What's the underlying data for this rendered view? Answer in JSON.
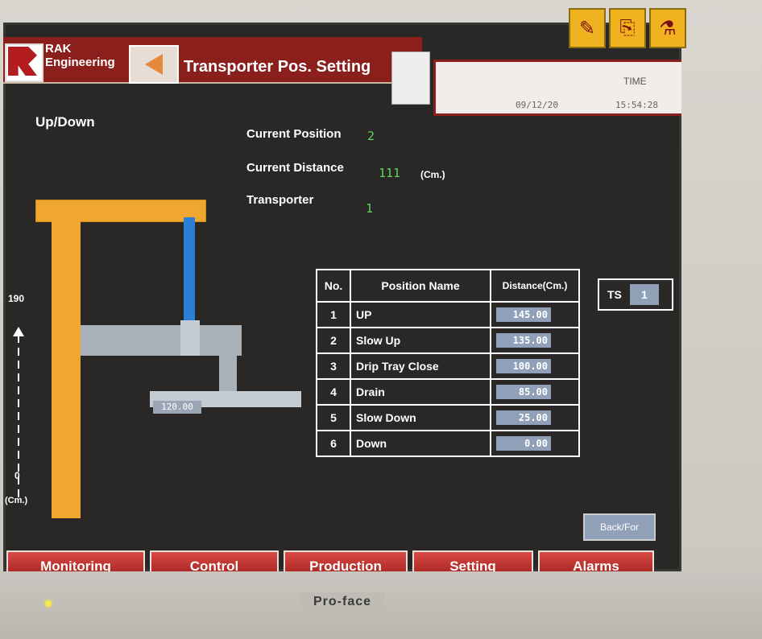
{
  "header": {
    "company_line1": "RAK",
    "company_line2": "Engineering",
    "screen_title": "Transporter Pos. Setting",
    "time_label": "TIME",
    "time_value": "15:54:28",
    "date_value": "09/12/20"
  },
  "info": {
    "section_title": "Up/Down",
    "current_position_label": "Current Position",
    "current_position_value": "2",
    "current_distance_label": "Current Distance",
    "current_distance_value": "111",
    "current_distance_unit": "(Cm.)",
    "transporter_label": "Transporter",
    "transporter_value": "1"
  },
  "diagram": {
    "axis_max": "190",
    "axis_min": "0",
    "axis_unit": "(Cm.)",
    "tray_value": "120.00"
  },
  "table": {
    "headers": {
      "no": "No.",
      "name": "Position Name",
      "distance": "Distance(Cm.)"
    },
    "rows": [
      {
        "no": "1",
        "name": "UP",
        "distance": "145.00"
      },
      {
        "no": "2",
        "name": "Slow Up",
        "distance": "135.00"
      },
      {
        "no": "3",
        "name": "Drip Tray Close",
        "distance": "100.00"
      },
      {
        "no": "4",
        "name": "Drain",
        "distance": "85.00"
      },
      {
        "no": "5",
        "name": "Slow Down",
        "distance": "25.00"
      },
      {
        "no": "6",
        "name": "Down",
        "distance": "0.00"
      }
    ]
  },
  "ts": {
    "label": "TS",
    "value": "1"
  },
  "back_button": "Back/For",
  "nav": [
    "Monitoring",
    "Control",
    "Production",
    "Setting",
    "Alarms"
  ],
  "bezel": {
    "brand": "Pro-face"
  },
  "colors": {
    "header_red": "#8a1f1c",
    "beam_orange": "#f0a72f",
    "cable_blue": "#2d7fd6",
    "value_green": "#5fd35f"
  }
}
